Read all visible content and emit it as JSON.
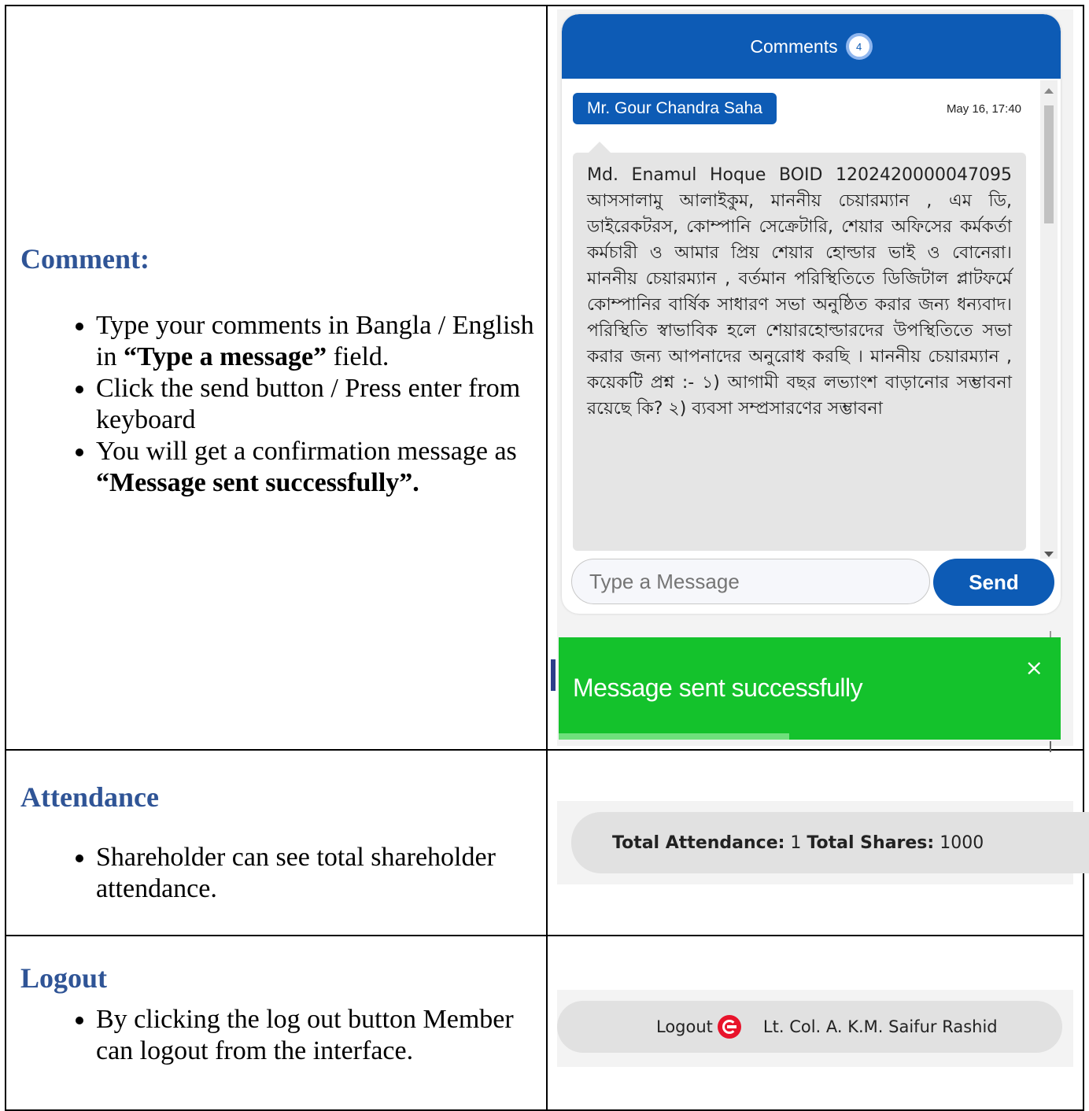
{
  "comment_section": {
    "heading": "Comment:",
    "bullets": [
      {
        "pre": "Type your comments in Bangla / English in ",
        "bold": "“Type a message”",
        "post": " field."
      },
      {
        "pre": "Click the send button / Press enter from keyboard",
        "bold": "",
        "post": ""
      },
      {
        "pre": "You will get a confirmation message as ",
        "bold": "“Message sent successfully”.",
        "post": ""
      }
    ]
  },
  "comments_widget": {
    "title": "Comments",
    "count": "4",
    "author": "Mr. Gour Chandra Saha",
    "timestamp": "May 16, 17:40",
    "message": "Md. Enamul Hoque BOID 1202420000047095 আসসালামু আলাইকুম, মাননীয় চেয়ারম্যান , এম ডি, ডাইরেকটরস, কোম্পানি সেক্রেটারি, শেয়ার অফিসের কর্মকর্তা কর্মচারী ও আমার প্রিয় শেয়ার হোল্ডার ভাই ও বোনেরা। মাননীয় চেয়ারম্যান , বর্তমান পরিস্থিতিতে ডিজিটাল প্লাটফর্মে কোম্পানির বার্ষিক সাধারণ সভা অনুষ্ঠিত করার জন্য ধন্যবাদ। পরিস্থিতি স্বাভাবিক হলে শেয়ারহোল্ডারদের উপস্থিতিতে সভা করার জন্য আপনাদের অনুরোধ করছি । মাননীয় চেয়ারম্যান , কয়েকটি প্রশ্ন :- ১) আগামী বছর লভ্যাংশ বাড়ানোর সম্ভাবনা রয়েছে কি? ২) ব্যবসা সম্প্রসারণের সম্ভাবনা",
    "input_placeholder": "Type a Message",
    "send_label": "Send"
  },
  "toast": {
    "text": "Message sent successfully",
    "close": "×",
    "progress": 0.46
  },
  "attendance_section": {
    "heading": "Attendance",
    "bullets": [
      {
        "pre": "Shareholder can see total shareholder attendance.",
        "bold": "",
        "post": ""
      }
    ],
    "attendance_label": "Total Attendance:",
    "attendance_value": "1",
    "shares_label": "Total Shares:",
    "shares_value": "1000"
  },
  "logout_section": {
    "heading": "Logout",
    "bullets": [
      {
        "pre": "By clicking the log out button Member can logout from the interface.",
        "bold": "",
        "post": ""
      }
    ],
    "logout_label": "Logout",
    "user_name": "Lt. Col. A. K.M. Saifur Rashid"
  }
}
